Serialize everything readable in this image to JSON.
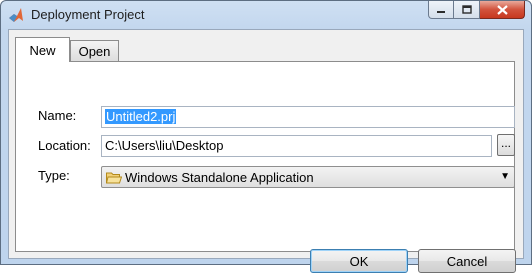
{
  "window": {
    "title": "Deployment Project"
  },
  "tabs": [
    {
      "label": "New",
      "active": true
    },
    {
      "label": "Open",
      "active": false
    }
  ],
  "form": {
    "name_label": "Name:",
    "name_value": "Untitled2.prj",
    "location_label": "Location:",
    "location_value": "C:\\Users\\liu\\Desktop",
    "browse_label": "...",
    "type_label": "Type:",
    "type_value": "Windows Standalone Application"
  },
  "buttons": {
    "ok": "OK",
    "cancel": "Cancel"
  },
  "icons": {
    "app": "matlab-logo-icon",
    "minimize": "minimize-icon",
    "maximize": "maximize-icon",
    "close": "close-icon",
    "folder": "folder-icon",
    "dropdown": "chevron-down-icon"
  },
  "colors": {
    "selection": "#3399ff",
    "close_button": "#c7381f",
    "title_bar": "#c3d7ee"
  }
}
